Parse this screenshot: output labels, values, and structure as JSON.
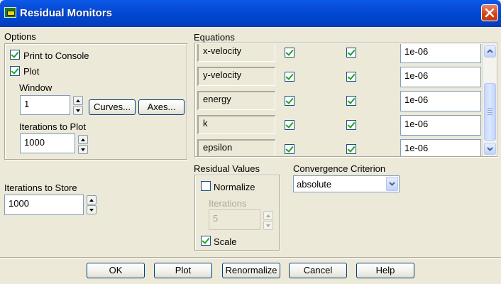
{
  "window": {
    "title": "Residual Monitors"
  },
  "options": {
    "legend": "Options",
    "print_to_console": {
      "label": "Print to Console",
      "checked": true
    },
    "plot": {
      "label": "Plot",
      "checked": true
    },
    "window_label": "Window",
    "window_value": "1",
    "curves_button": "Curves...",
    "axes_button": "Axes...",
    "iterations_to_plot_label": "Iterations to Plot",
    "iterations_to_plot_value": "1000"
  },
  "iterations_to_store": {
    "label": "Iterations to Store",
    "value": "1000"
  },
  "equations": {
    "legend": "Equations",
    "rows": [
      {
        "name": "x-velocity",
        "monitor": true,
        "check_convergence": true,
        "criterion": "1e-06"
      },
      {
        "name": "y-velocity",
        "monitor": true,
        "check_convergence": true,
        "criterion": "1e-06"
      },
      {
        "name": "energy",
        "monitor": true,
        "check_convergence": true,
        "criterion": "1e-06"
      },
      {
        "name": "k",
        "monitor": true,
        "check_convergence": true,
        "criterion": "1e-06"
      },
      {
        "name": "epsilon",
        "monitor": true,
        "check_convergence": true,
        "criterion": "1e-06"
      }
    ]
  },
  "residual_values": {
    "legend": "Residual Values",
    "normalize": {
      "label": "Normalize",
      "checked": false
    },
    "iterations_label": "Iterations",
    "iterations_value": "5",
    "scale": {
      "label": "Scale",
      "checked": true
    }
  },
  "convergence": {
    "legend": "Convergence Criterion",
    "selected": "absolute"
  },
  "buttons": {
    "ok": "OK",
    "plot": "Plot",
    "renormalize": "Renormalize",
    "cancel": "Cancel",
    "help": "Help"
  }
}
